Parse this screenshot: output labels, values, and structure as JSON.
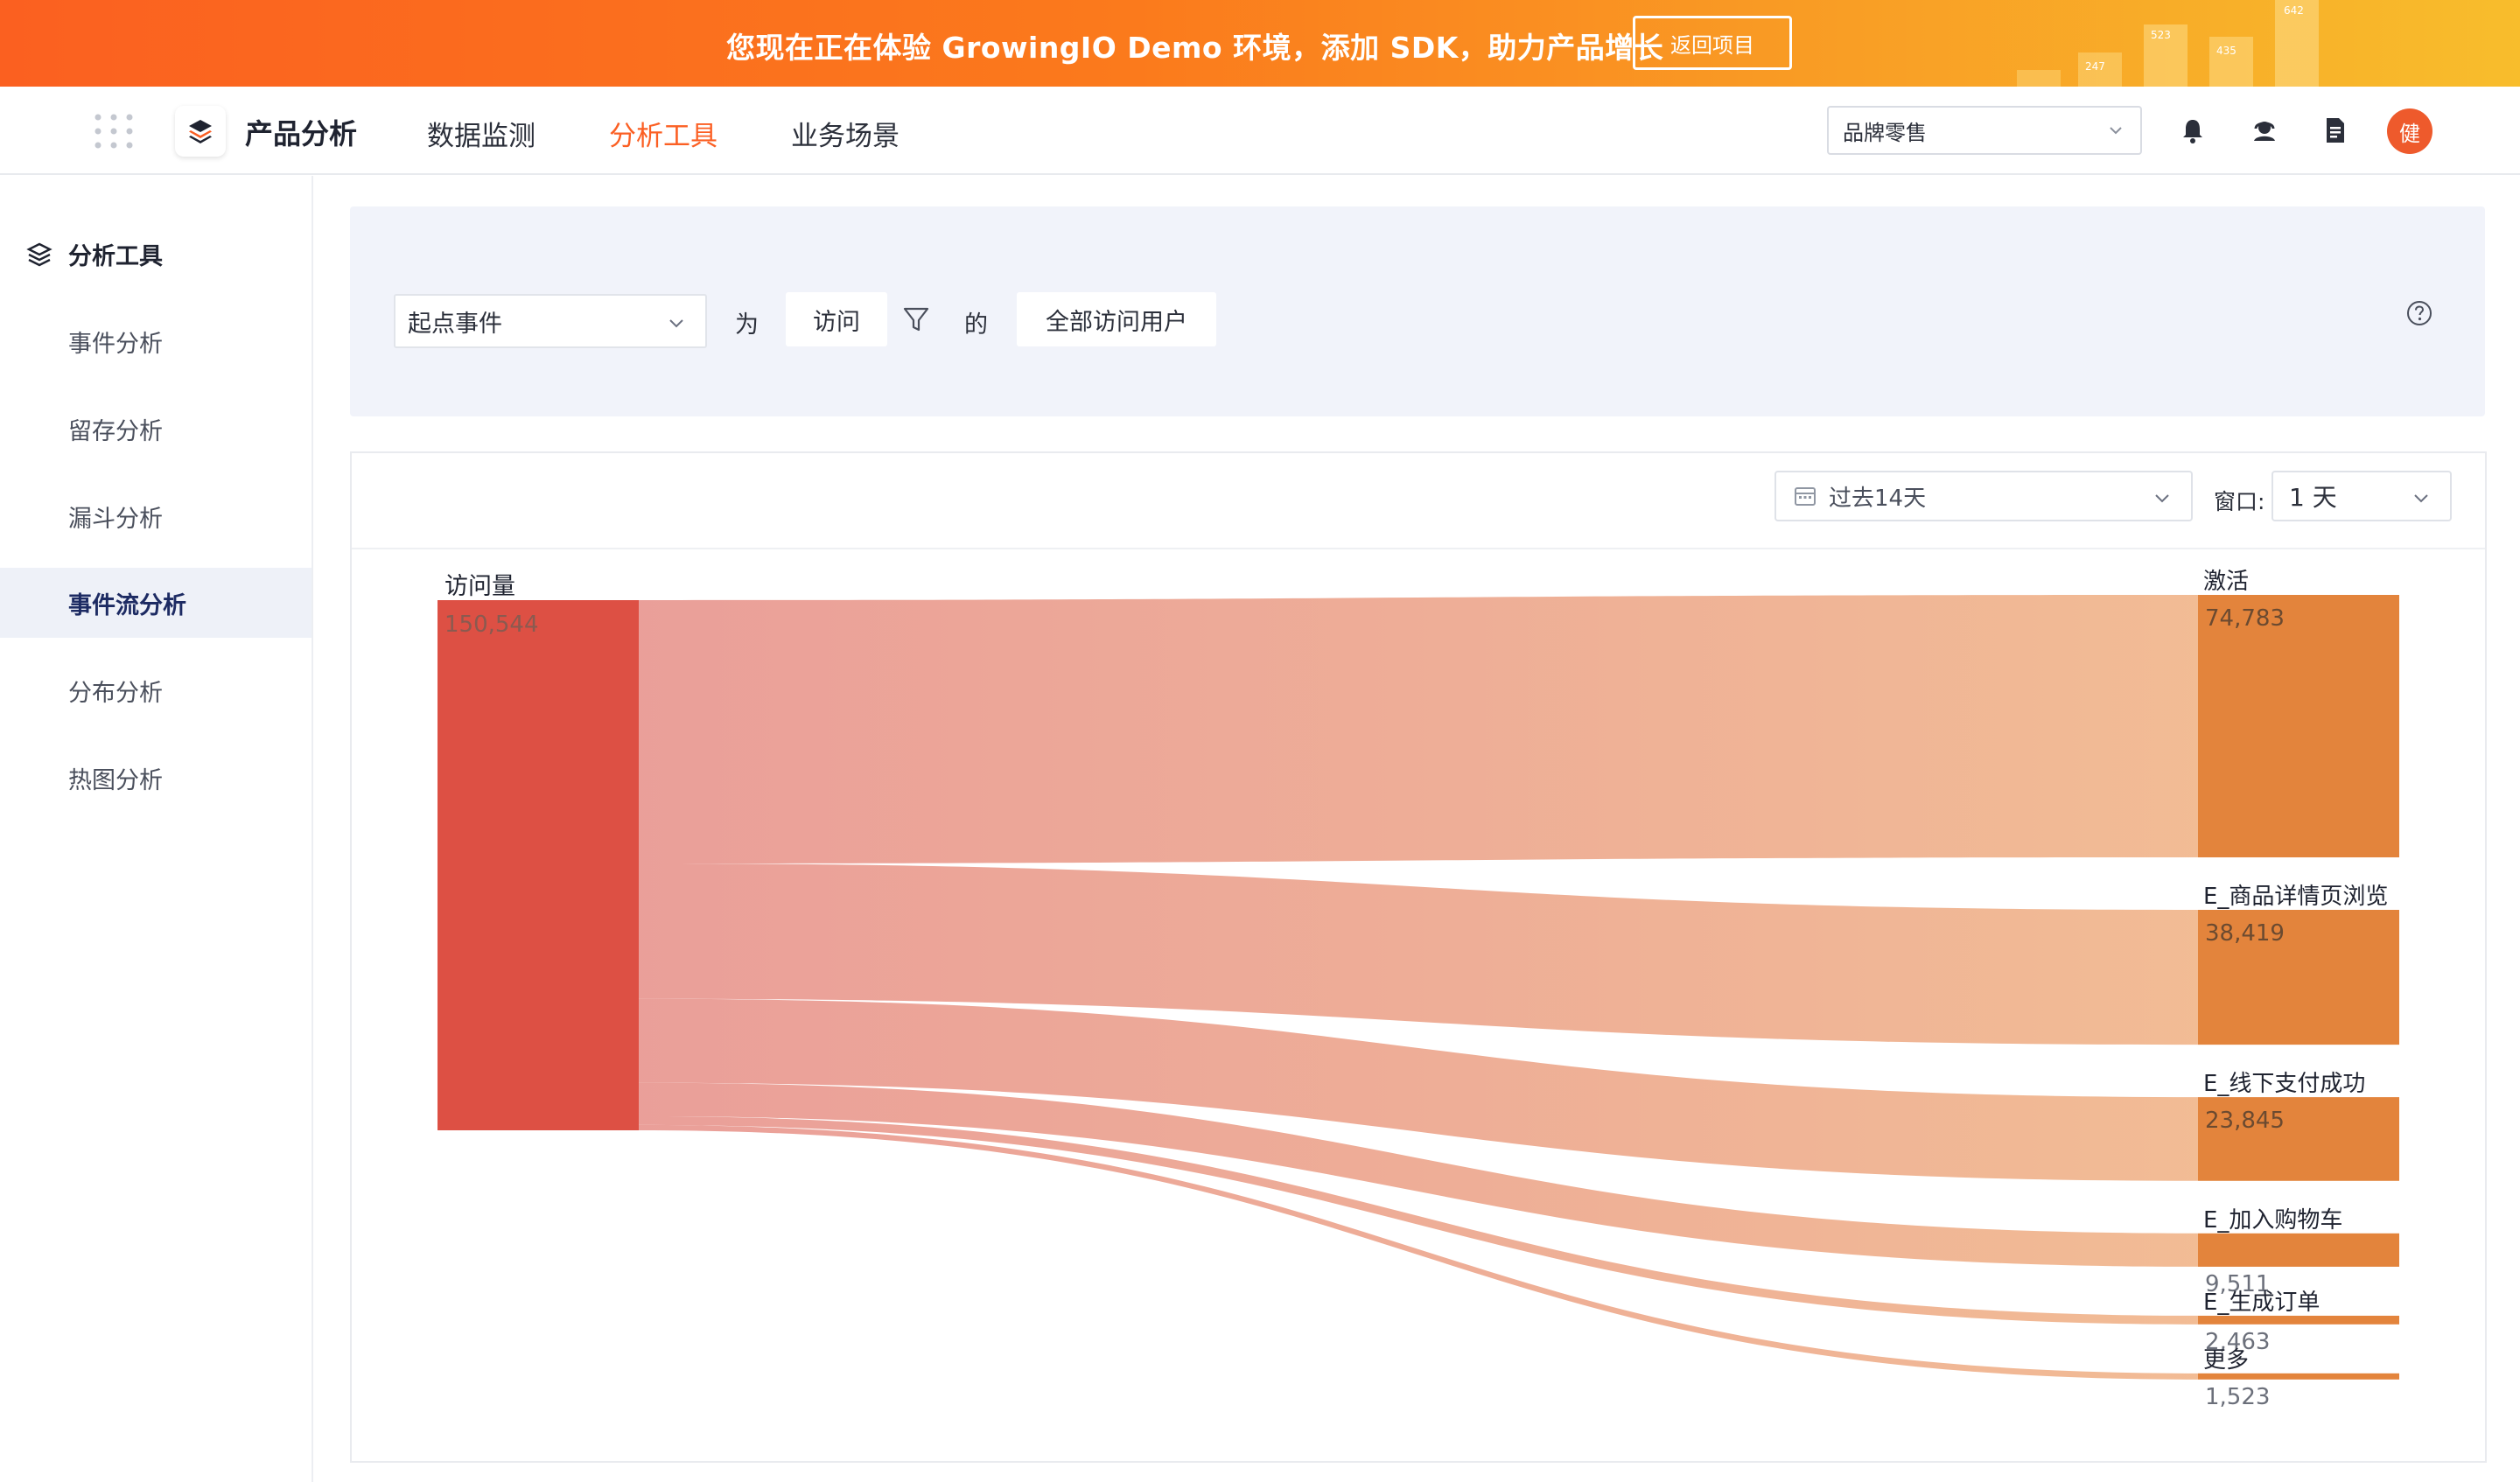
{
  "banner": {
    "message": "您现在正在体验 GrowingIO Demo 环境，添加 SDK，助力产品增长",
    "button_label": "返回项目",
    "deco_numbers": [
      "247",
      "523",
      "435",
      "642"
    ]
  },
  "nav": {
    "brand": "产品分析",
    "items": [
      {
        "label": "数据监测",
        "active": false
      },
      {
        "label": "分析工具",
        "active": true
      },
      {
        "label": "业务场景",
        "active": false
      }
    ],
    "project_select": "品牌零售",
    "avatar_text": "健",
    "icons": [
      "bell-icon",
      "support-icon",
      "document-icon"
    ]
  },
  "sidebar": {
    "heading": "分析工具",
    "items": [
      {
        "label": "事件分析",
        "active": false
      },
      {
        "label": "留存分析",
        "active": false
      },
      {
        "label": "漏斗分析",
        "active": false
      },
      {
        "label": "事件流分析",
        "active": true
      },
      {
        "label": "分布分析",
        "active": false
      },
      {
        "label": "热图分析",
        "active": false
      }
    ]
  },
  "query": {
    "start_event_select": "起点事件",
    "word_as": "为",
    "event_chip": "访问",
    "word_of": "的",
    "users_chip": "全部访问用户"
  },
  "controls": {
    "date_range": "过去14天",
    "window_label": "窗口:",
    "window_value": "1 天"
  },
  "colors": {
    "accent": "#fb5f23",
    "source_node": "#dd5044",
    "target_node": "#e3843c",
    "link_start": "#e99a94",
    "link_end": "#f1b88f"
  },
  "chart_data": {
    "type": "sankey",
    "source": {
      "name": "访问量",
      "value": 150544
    },
    "targets": [
      {
        "name": "激活",
        "value": 74783
      },
      {
        "name": "E_商品详情页浏览",
        "value": 38419
      },
      {
        "name": "E_线下支付成功",
        "value": 23845
      },
      {
        "name": "E_加入购物车",
        "value": 9511
      },
      {
        "name": "E_生成订单",
        "value": 2463
      },
      {
        "name": "更多",
        "value": 1523
      }
    ]
  }
}
